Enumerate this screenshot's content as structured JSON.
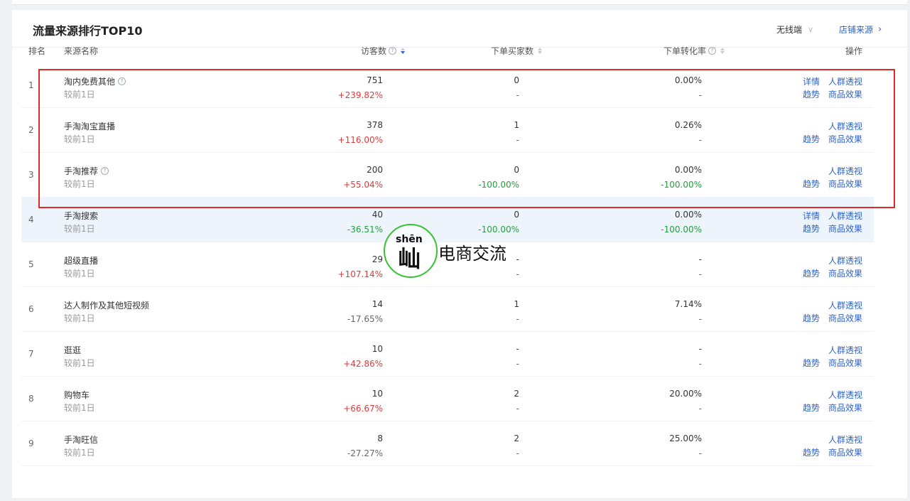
{
  "card": {
    "title": "流量来源排行TOP10",
    "device_select": "无线端",
    "store_source_link": "店铺来源"
  },
  "table": {
    "headers": {
      "rank": "排名",
      "source_name": "来源名称",
      "visitors": "访客数",
      "buyers": "下单买家数",
      "conversion": "下单转化率",
      "actions": "操作"
    },
    "rows": [
      {
        "rank": "1",
        "name": "淘内免费其他",
        "has_help": true,
        "sub": "较前1日",
        "visitors": "751",
        "visitors_change": "+239.82%",
        "visitors_trend": "up",
        "buyers": "0",
        "buyers_change": "-",
        "buyers_trend": "none",
        "rate": "0.00%",
        "rate_change": "-",
        "rate_trend": "none",
        "ops": [
          "详情",
          "人群透视",
          "趋势",
          "商品效果"
        ],
        "highlight": false
      },
      {
        "rank": "2",
        "name": "手淘淘宝直播",
        "has_help": false,
        "sub": "较前1日",
        "visitors": "378",
        "visitors_change": "+116.00%",
        "visitors_trend": "up",
        "buyers": "1",
        "buyers_change": "-",
        "buyers_trend": "none",
        "rate": "0.26%",
        "rate_change": "-",
        "rate_trend": "none",
        "ops": [
          "",
          "人群透视",
          "趋势",
          "商品效果"
        ],
        "highlight": false
      },
      {
        "rank": "3",
        "name": "手淘推荐",
        "has_help": true,
        "sub": "较前1日",
        "visitors": "200",
        "visitors_change": "+55.04%",
        "visitors_trend": "up",
        "buyers": "0",
        "buyers_change": "-100.00%",
        "buyers_trend": "down",
        "rate": "0.00%",
        "rate_change": "-100.00%",
        "rate_trend": "down",
        "ops": [
          "",
          "人群透视",
          "趋势",
          "商品效果"
        ],
        "highlight": false
      },
      {
        "rank": "4",
        "name": "手淘搜索",
        "has_help": false,
        "sub": "较前1日",
        "visitors": "40",
        "visitors_change": "-36.51%",
        "visitors_trend": "down",
        "buyers": "0",
        "buyers_change": "-100.00%",
        "buyers_trend": "down",
        "rate": "0.00%",
        "rate_change": "-100.00%",
        "rate_trend": "down",
        "ops": [
          "详情",
          "人群透视",
          "趋势",
          "商品效果"
        ],
        "highlight": true
      },
      {
        "rank": "5",
        "name": "超级直播",
        "has_help": false,
        "sub": "较前1日",
        "visitors": "29",
        "visitors_change": "+107.14%",
        "visitors_trend": "up",
        "buyers": "-",
        "buyers_change": "-",
        "buyers_trend": "none",
        "rate": "-",
        "rate_change": "-",
        "rate_trend": "none",
        "ops": [
          "",
          "人群透视",
          "趋势",
          "商品效果"
        ],
        "highlight": false
      },
      {
        "rank": "6",
        "name": "达人制作及其他短视频",
        "has_help": false,
        "sub": "较前1日",
        "visitors": "14",
        "visitors_change": "-17.65%",
        "visitors_trend": "neutral",
        "buyers": "1",
        "buyers_change": "-",
        "buyers_trend": "none",
        "rate": "7.14%",
        "rate_change": "-",
        "rate_trend": "none",
        "ops": [
          "",
          "人群透视",
          "趋势",
          "商品效果"
        ],
        "highlight": false
      },
      {
        "rank": "7",
        "name": "逛逛",
        "has_help": false,
        "sub": "较前1日",
        "visitors": "10",
        "visitors_change": "+42.86%",
        "visitors_trend": "up",
        "buyers": "-",
        "buyers_change": "-",
        "buyers_trend": "none",
        "rate": "-",
        "rate_change": "-",
        "rate_trend": "none",
        "ops": [
          "",
          "人群透视",
          "趋势",
          "商品效果"
        ],
        "highlight": false
      },
      {
        "rank": "8",
        "name": "购物车",
        "has_help": false,
        "sub": "较前1日",
        "visitors": "10",
        "visitors_change": "+66.67%",
        "visitors_trend": "up",
        "buyers": "2",
        "buyers_change": "-",
        "buyers_trend": "none",
        "rate": "20.00%",
        "rate_change": "-",
        "rate_trend": "none",
        "ops": [
          "",
          "人群透视",
          "趋势",
          "商品效果"
        ],
        "highlight": false
      },
      {
        "rank": "9",
        "name": "手淘旺信",
        "has_help": false,
        "sub": "较前1日",
        "visitors": "8",
        "visitors_change": "-27.27%",
        "visitors_trend": "neutral",
        "buyers": "2",
        "buyers_change": "-",
        "buyers_trend": "none",
        "rate": "25.00%",
        "rate_change": "-",
        "rate_trend": "none",
        "ops": [
          "",
          "人群透视",
          "趋势",
          "商品效果"
        ],
        "highlight": false
      }
    ]
  },
  "watermark": {
    "pinyin": "shēn",
    "char": "屾",
    "text": "电商交流"
  },
  "colors": {
    "accent": "#2d63c8",
    "increase": "#e23a3a",
    "decrease": "#22a03c",
    "highlight_box": "#e02a2a",
    "highlight_row": "#eef4fc"
  }
}
